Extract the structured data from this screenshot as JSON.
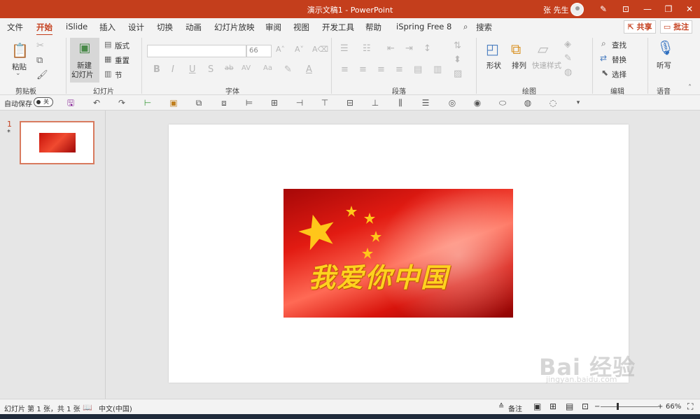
{
  "titlebar": {
    "title": "演示文稿1  -  PowerPoint",
    "user": "张 先生",
    "controls": [
      "✎",
      "⊡",
      "—",
      "❐",
      "✕"
    ]
  },
  "tabs": [
    "文件",
    "开始",
    "iSlide",
    "插入",
    "设计",
    "切换",
    "动画",
    "幻灯片放映",
    "审阅",
    "视图",
    "开发工具",
    "帮助",
    "iSpring Free 8",
    "搜索"
  ],
  "active_tab": "开始",
  "share_label": "共享",
  "comment_label": "批注",
  "ribbon": {
    "clipboard": {
      "paste": "粘贴",
      "group": "剪贴板"
    },
    "slides": {
      "new_slide_line1": "新建",
      "new_slide_line2": "幻灯片",
      "layout": "版式",
      "reset": "重置",
      "section": "节",
      "group": "幻灯片"
    },
    "font": {
      "size": "66",
      "group": "字体"
    },
    "paragraph": {
      "group": "段落"
    },
    "drawing": {
      "shapes": "形状",
      "arrange": "排列",
      "quick_styles": "快速样式",
      "group": "绘图"
    },
    "editing": {
      "find": "查找",
      "replace": "替换",
      "select": "选择",
      "group": "编辑"
    },
    "voice": {
      "dictate": "听写",
      "group": "语音"
    }
  },
  "qat": {
    "autosave": "自动保存",
    "toggle": "关"
  },
  "slides_panel": {
    "number": "1",
    "marker": "*"
  },
  "slide": {
    "caption": "我爱你中国"
  },
  "status": {
    "slide_info": "幻灯片 第 1 张，共 1 张",
    "language": "中文(中国)",
    "notes": "备注",
    "zoom": "66%"
  },
  "watermark": {
    "brand": "Bai 经验",
    "url": "jingyan.baidu.com"
  },
  "colors": {
    "accent": "#c43e1c",
    "ribbon_bg": "#f3f3f3",
    "canvas_bg": "#e6e6e6"
  }
}
